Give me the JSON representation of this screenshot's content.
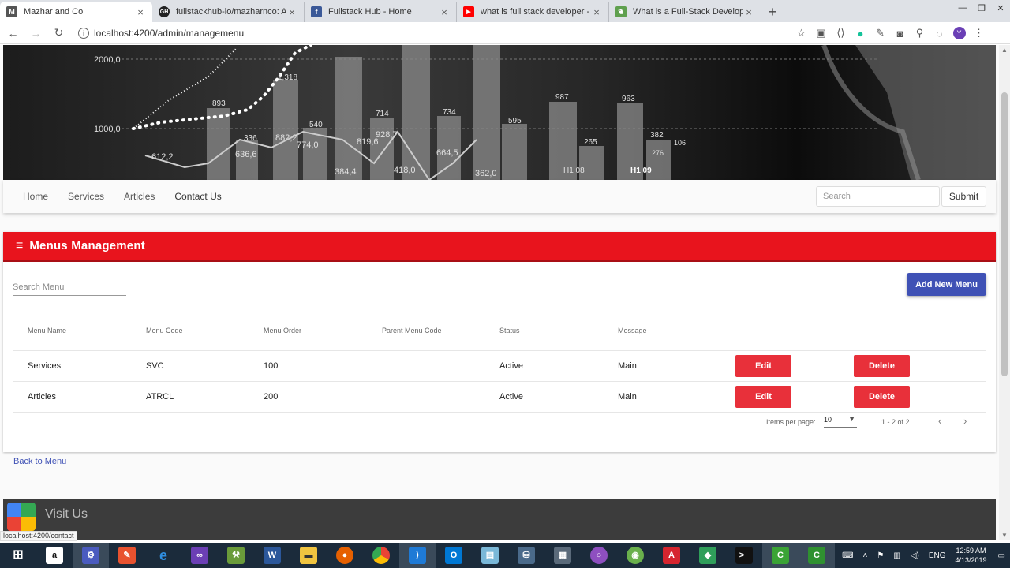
{
  "browser": {
    "tabs": [
      {
        "title": "Mazhar and Co",
        "icon": "M",
        "color": "#555555"
      },
      {
        "title": "fullstackhub-io/mazharnco: A Co",
        "icon": "GH",
        "color": "#222222"
      },
      {
        "title": "Fullstack Hub - Home",
        "icon": "f",
        "color": "#3b5998"
      },
      {
        "title": "what is full stack developer - You",
        "icon": "▶",
        "color": "#ff0000"
      },
      {
        "title": "What is a Full-Stack Developer?",
        "icon": "❦",
        "color": "#5fa04e"
      }
    ],
    "url": "localhost:4200/admin/managemenu"
  },
  "hero": {
    "y_labels": [
      "2000,0",
      "1000,0"
    ],
    "chart_labels": [
      "612,2",
      "893",
      "1,318",
      "336",
      "882,2",
      "774,0",
      "540",
      "636,6",
      "714",
      "819,6",
      "928,7",
      "734",
      "664,5",
      "595",
      "987",
      "265",
      "963",
      "382",
      "106",
      "276",
      "384,4",
      "418,0",
      "362,0",
      "H1 08",
      "H1 09"
    ]
  },
  "nav": {
    "items": [
      "Home",
      "Services",
      "Articles",
      "Contact Us"
    ],
    "search_placeholder": "Search",
    "submit_label": "Submit"
  },
  "card": {
    "title": "Menus Management",
    "search_placeholder": "Search Menu",
    "add_button": "Add New Menu",
    "columns": [
      "Menu Name",
      "Menu Code",
      "Menu Order",
      "Parent Menu Code",
      "Status",
      "Message"
    ],
    "rows": [
      {
        "name": "Services",
        "code": "SVC",
        "order": "100",
        "parent": "",
        "status": "Active",
        "message": "Main",
        "edit": "Edit",
        "delete": "Delete"
      },
      {
        "name": "Articles",
        "code": "ATRCL",
        "order": "200",
        "parent": "",
        "status": "Active",
        "message": "Main",
        "edit": "Edit",
        "delete": "Delete"
      }
    ],
    "paginator": {
      "items_per_page_label": "Items per page:",
      "items_per_page": "10",
      "range": "1 - 2 of 2"
    }
  },
  "back_link": "Back to Menu",
  "footer": {
    "title": "Visit Us"
  },
  "status_url": "localhost:4200/contact",
  "taskbar": {
    "lang": "ENG",
    "time": "12:59 AM",
    "date": "4/13/2019"
  },
  "colors": {
    "header_red": "#e8141d",
    "button_red": "#e8303a",
    "primary_blue": "#3f51b5"
  }
}
